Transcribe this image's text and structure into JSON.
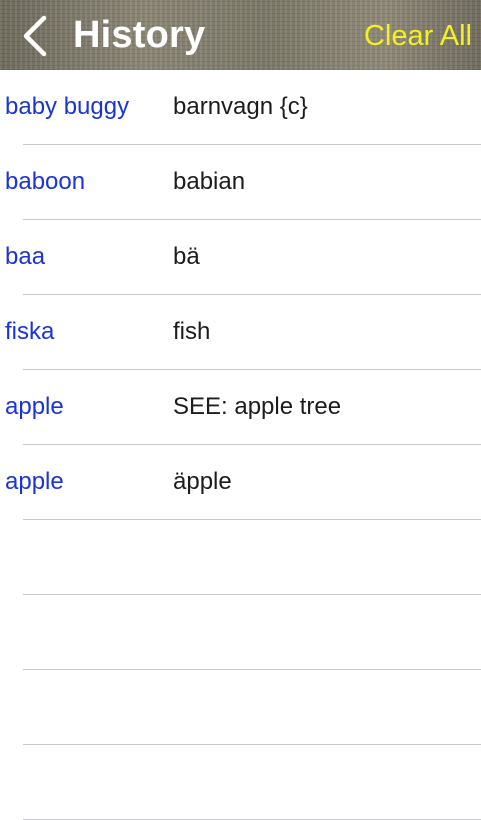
{
  "header": {
    "title": "History",
    "clear_all_label": "Clear All",
    "back_icon": "chevron-left-icon"
  },
  "history": [
    {
      "term": "baby buggy",
      "translation": "barnvagn {c}"
    },
    {
      "term": "baboon",
      "translation": "babian"
    },
    {
      "term": "baa",
      "translation": "bä"
    },
    {
      "term": "fiska",
      "translation": "fish"
    },
    {
      "term": "apple",
      "translation": "SEE: apple tree"
    },
    {
      "term": "apple",
      "translation": "äpple"
    }
  ],
  "colors": {
    "term": "#1a34d8",
    "translation": "#1c1c1c",
    "clear_all": "#f5f01f",
    "title": "#ffffff"
  }
}
